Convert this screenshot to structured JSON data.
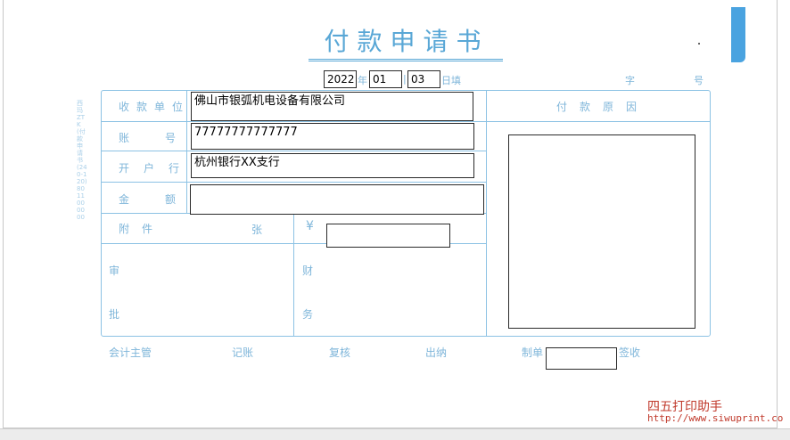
{
  "form": {
    "title": "付款申请书",
    "date": {
      "year": "2022",
      "year_label": "年",
      "month": "01",
      "month_sep": "|",
      "day": "03",
      "fill_label": "日填"
    },
    "zi_label": "字",
    "hao_label": "号",
    "vertical_side_text": "西玛 ZTK(付款申请书(240-120) 8011000000"
  },
  "fields": {
    "payee_label": "收款单位",
    "payee_value": "佛山市银弧机电设备有限公司",
    "account_label": "账号",
    "account_value": "77777777777777",
    "bank_label": "开户行",
    "bank_value": "杭州银行XX支行",
    "amount_label": "金额",
    "amount_value": "",
    "attachment_label": "附件",
    "sheet_label": "张",
    "yen_symbol": "¥",
    "yen_value": "",
    "shen_label": "审",
    "pi_label": "批",
    "cai_label": "财",
    "wu_label": "务",
    "reason_label": "付款原因",
    "reason_value": ""
  },
  "footer": {
    "accountant_label": "会计主管",
    "bookkeeping_label": "记账",
    "review_label": "复核",
    "cashier_label": "出纳",
    "maker_label": "制单",
    "maker_value": "",
    "sign_label": "签收"
  },
  "watermark": {
    "name": "四五打印助手",
    "url": "http://www.siwuprint.co"
  },
  "colors": {
    "form_blue": "#7fb6da",
    "title_blue": "#59a7d6",
    "tab_blue": "#4aa3e0",
    "watermark_red": "#c0392b"
  }
}
